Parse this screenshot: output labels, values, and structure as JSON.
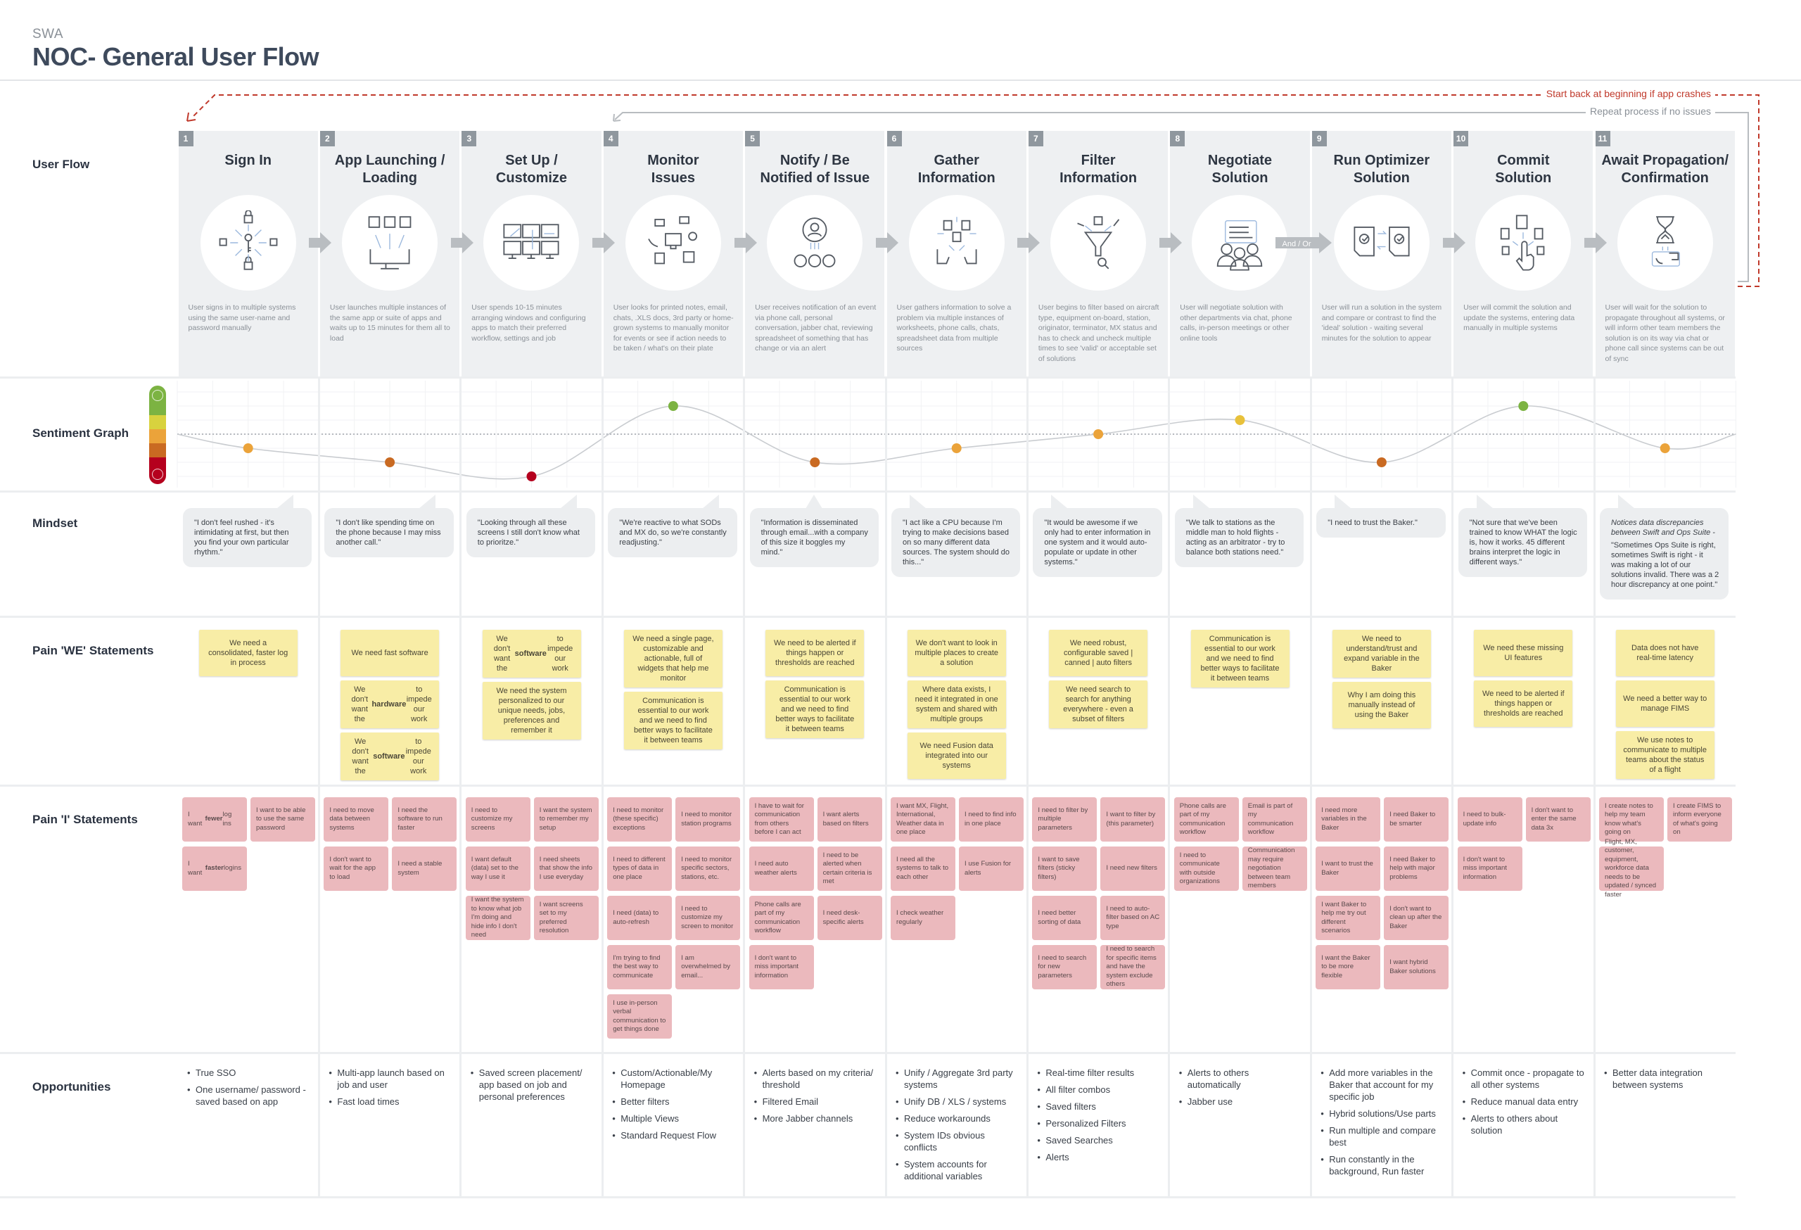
{
  "header": {
    "org": "SWA",
    "title": "NOC- General User Flow"
  },
  "loops": {
    "crash_label": "Start back at beginning if app crashes",
    "repeat_label": "Repeat process if no issues",
    "crash_color": "#c0392b",
    "repeat_color": "#b8bcc0"
  },
  "row_labels": {
    "flow": "User Flow",
    "sentiment": "Sentiment Graph",
    "mindset": "Mindset",
    "we": "Pain 'WE' Statements",
    "i": "Pain 'I' Statements",
    "opportunities": "Opportunities"
  },
  "connectors": {
    "and_or_label": "And / Or"
  },
  "colors": {
    "flow_bg": "#eef0f2",
    "we_note": "#f8eda6",
    "i_note": "#ebb9bd",
    "badge": "#8f979e"
  },
  "sentiment": {
    "range": [
      -3,
      2
    ],
    "neutral": 0,
    "scale_colors": [
      "#7cb342",
      "#d8d23e",
      "#eba33a",
      "#c96a22",
      "#b5001e"
    ],
    "level_colors": {
      "2": "#7cb342",
      "1": "#e8c13a",
      "0": "#eba33a",
      "-1": "#eba33a",
      "-2": "#c96a22",
      "-3": "#b5001e"
    },
    "values": [
      -1,
      -2,
      -3,
      2,
      -2,
      -1,
      0,
      1,
      -2,
      2,
      -1
    ]
  },
  "steps": [
    {
      "number": "1",
      "title": "Sign In",
      "icon": "lock-key-icon",
      "description": "User signs in to multiple systems using the same user-name and password manually",
      "mindset": "\"I don't feel rushed - it's intimidating at first, but then you find your own particular rhythm.\"",
      "we": [
        "We need a consolidated, faster log in process"
      ],
      "i": [
        [
          {
            "text": "I want fewer log ins",
            "bold": "fewer"
          },
          "I want to be able to use the same password"
        ],
        [
          {
            "text": "I want faster logins",
            "bold": "faster"
          },
          null
        ]
      ],
      "opportunities": [
        "True SSO",
        "One username/ password - saved based on app"
      ]
    },
    {
      "number": "2",
      "title": "App Launching /\nLoading",
      "icon": "monitor-launch-icon",
      "description": "User launches multiple instances of the same app or suite of apps and waits up to 15 minutes for them all to load",
      "mindset": "\"I don't like spending time on the phone because I may miss another call.\"",
      "we": [
        "We need fast software",
        {
          "text": "We don't want the hardware to impede our work",
          "bold": "hardware"
        },
        {
          "text": "We don't want the software to impede our work",
          "bold": "software"
        }
      ],
      "i": [
        [
          "I need to move data between systems",
          "I need the software to run faster"
        ],
        [
          "I don't want to wait for the app to load",
          "I need a stable system"
        ]
      ],
      "opportunities": [
        "Multi-app launch based on job and user",
        "Fast load times"
      ]
    },
    {
      "number": "3",
      "title": "Set Up /\nCustomize",
      "icon": "multi-monitor-icon",
      "description": "User spends 10-15 minutes arranging windows and configuring apps to match their preferred workflow, settings and job",
      "mindset": "\"Looking through all these screens I still don't know what to prioritze.\"",
      "we": [
        {
          "text": "We don't want the software to impede our work",
          "bold": "software"
        },
        "We need the system personalized to our unique needs, jobs, preferences and remember it"
      ],
      "i": [
        [
          "I need to customize my screens",
          "I want the system to remember my setup"
        ],
        [
          "I want default (data) set to the way I use it",
          "I need sheets that show the info I use everyday"
        ],
        [
          "I want the system to know what job I'm doing and hide info I don't need",
          "I want screens set to my preferred resolution"
        ]
      ],
      "opportunities": [
        "Saved screen placement/ app based on job and personal preferences"
      ]
    },
    {
      "number": "4",
      "title": "Monitor\nIssues",
      "icon": "monitor-docs-icon",
      "description": "User looks for printed notes, email, chats, .XLS docs, 3rd party or home-grown systems to manually monitor for events or see if action needs to be taken / what's on their plate",
      "mindset": "\"We're reactive to what SODs and MX do, so we're constantly readjusting.\"",
      "we": [
        "We need a single page, customizable and actionable, full of widgets that help me monitor",
        "Communication is essential to our work and we need to find better ways to facilitate it between teams"
      ],
      "i": [
        [
          "I need to monitor (these specific) exceptions",
          "I need to monitor station programs"
        ],
        [
          "I need to different types of data in one place",
          "I need to monitor specific sectors, stations, etc."
        ],
        [
          "I need (data) to auto-refresh",
          "I need to customize my screen to monitor"
        ],
        [
          "I'm trying to find the best way to communicate",
          "I am overwhelmed by email..."
        ],
        [
          "I use in-person verbal communication to get things done",
          null
        ]
      ],
      "opportunities": [
        "Custom/Actionable/My Homepage",
        "Better filters",
        "Multiple Views",
        "Standard Request Flow"
      ]
    },
    {
      "number": "5",
      "title": "Notify / Be\nNotified of Issue",
      "icon": "notification-person-icon",
      "description": "User receives notification of an event via phone call, personal conversation, jabber chat, reviewing spreadsheet of something that has change or via an alert",
      "mindset": "\"Information is disseminated through email...with a company of this size it boggles my mind.\"",
      "we": [
        "We need to be alerted if things happen or thresholds are reached",
        "Communication is essential to our work and we need to find better ways to facilitate it between teams"
      ],
      "i": [
        [
          "I have to wait for communication from others before I can act",
          "I want alerts based on filters"
        ],
        [
          "I need auto weather alerts",
          "I need to be alerted when certain criteria is met"
        ],
        [
          "Phone calls are part of my communication workflow",
          "I need desk-specific alerts"
        ],
        [
          "I don't want to miss important information",
          null
        ]
      ],
      "opportunities": [
        "Alerts based on my criteria/ threshold",
        "Filtered Email",
        "More Jabber channels"
      ]
    },
    {
      "number": "6",
      "title": "Gather\nInformation",
      "icon": "gather-hands-icon",
      "description": "User gathers information to solve a problem via multiple instances of worksheets, phone calls, chats, spreadsheet data from multiple sources",
      "mindset": "\"I act like a CPU because I'm trying to make decisions based on so many different data sources. The system should do this...\"",
      "we": [
        "We don't want to look in multiple places to create a solution",
        "Where data exists, I need it integrated in one system and shared with multiple groups",
        "We need Fusion data integrated into our systems"
      ],
      "i": [
        [
          "I want MX, Flight, International, Weather data in one place",
          "I need to find info in one place"
        ],
        [
          "I need all the systems to talk to each other",
          "I use Fusion for alerts"
        ],
        [
          "I check weather regularly",
          null
        ]
      ],
      "opportunities": [
        "Unify / Aggregate 3rd party systems",
        "Unify DB / XLS / systems",
        "Reduce workarounds",
        "System IDs obvious conflicts",
        "System accounts for additional variables"
      ]
    },
    {
      "number": "7",
      "title": "Filter\nInformation",
      "icon": "filter-funnel-icon",
      "description": "User begins to filter based on aircraft type, equipment on-board, station, originator, terminator, MX status and has to check and uncheck multiple times to see 'valid' or acceptable set of solutions",
      "mindset": "\"It would be awesome if we only had to enter information in one system and it would auto-populate or update in other systems.\"",
      "we": [
        "We need robust, configurable saved | canned | auto filters",
        "We need search to search for anything everywhere - even a subset of filters"
      ],
      "i": [
        [
          "I need to filter by multiple parameters",
          "I want to filter by (this parameter)"
        ],
        [
          "I want to save filters (sticky filters)",
          "I need new filters"
        ],
        [
          "I need better sorting of data",
          "I need to auto-filter based on AC type"
        ],
        [
          "I need to search for new parameters",
          "I need to search for specific items and have the system exclude others"
        ]
      ],
      "opportunities": [
        "Real-time filter results",
        "All filter combos",
        "Saved filters",
        "Personalized Filters",
        "Saved Searches",
        "Alerts"
      ]
    },
    {
      "number": "8",
      "title": "Negotiate\nSolution",
      "icon": "team-chat-icon",
      "description": "User will negotiate solution with other departments via chat, phone calls, in-person meetings or other online tools",
      "mindset": "\"We talk to stations as the middle man to hold flights - acting as an arbitrator - try to balance both stations need.\"",
      "we": [
        "Communication is essential to our work and we need to find better ways to facilitate it between teams"
      ],
      "i": [
        [
          "Phone calls are part of my communication workflow",
          "Email is part of my communication workflow"
        ],
        [
          "I need to communicate with outside organizations",
          "Communication may require negotiation between team members"
        ]
      ],
      "opportunities": [
        "Alerts to others automatically",
        "Jabber use"
      ]
    },
    {
      "number": "9",
      "title": "Run Optimizer\nSolution",
      "icon": "optimizer-docs-icon",
      "description": "User will run a solution in the system and compare or contrast to find the 'ideal' solution - waiting several minutes for the solution to appear",
      "mindset": "\"I need to trust the Baker.\"",
      "we": [
        "We need to understand/trust and expand variable in the Baker",
        "Why I am doing this manually instead of using the Baker"
      ],
      "i": [
        [
          "I need more variables in the Baker",
          "I need Baker to be smarter"
        ],
        [
          "I want to trust the Baker",
          "I need Baker to help with major problems"
        ],
        [
          "I want Baker to help me try out different scenarios",
          "I don't want to clean up after the Baker"
        ],
        [
          "I want the Baker to be more flexible",
          "I want hybrid Baker solutions"
        ]
      ],
      "opportunities": [
        "Add more variables in the Baker that account for my specific job",
        "Hybrid solutions/Use parts",
        "Run multiple and compare best",
        "Run constantly in the background, Run faster"
      ]
    },
    {
      "number": "10",
      "title": "Commit\nSolution",
      "icon": "commit-touch-icon",
      "description": "User will commit the solution and update the systems, entering data manually in multiple systems",
      "mindset": "\"Not sure that we've been trained to know WHAT the logic is, how it works. 45 different brains interpret the logic in different ways.\"",
      "we": [
        "We need these missing UI features",
        "We need to be alerted if things happen or thresholds are reached"
      ],
      "i": [
        [
          "I need to bulk-update info",
          "I don't want to enter the same data 3x"
        ],
        [
          "I don't want to miss important information",
          null
        ]
      ],
      "opportunities": [
        "Commit once - propagate to all other systems",
        "Reduce manual data entry",
        "Alerts to others about solution"
      ]
    },
    {
      "number": "11",
      "title": "Await Propagation/\nConfirmation",
      "icon": "hourglass-icon",
      "description": "User will wait for the solution to propagate throughout all systems, or will inform other team members the solution is on its way via chat or phone call since systems can be out of sync",
      "mindset_note": "Notices data discrepancies between Swift and Ops Suite -",
      "mindset": "\"Sometimes Ops Suite is right, sometimes Swift is right - it was making a lot of our solutions invalid. There was a 2 hour discrepancy at one point.\"",
      "we": [
        "Data does not have real-time latency",
        "We need a better way to manage FIMS",
        "We use notes to communicate to multiple teams about the status of a flight"
      ],
      "i": [
        [
          "I create notes to help my team know what's going on",
          "I create FIMS to inform everyone of what's going on"
        ],
        [
          "Flight, MX, customer, equipment, workforce data needs to be updated / synced faster",
          null
        ]
      ],
      "opportunities": [
        "Better data integration between systems"
      ]
    }
  ]
}
